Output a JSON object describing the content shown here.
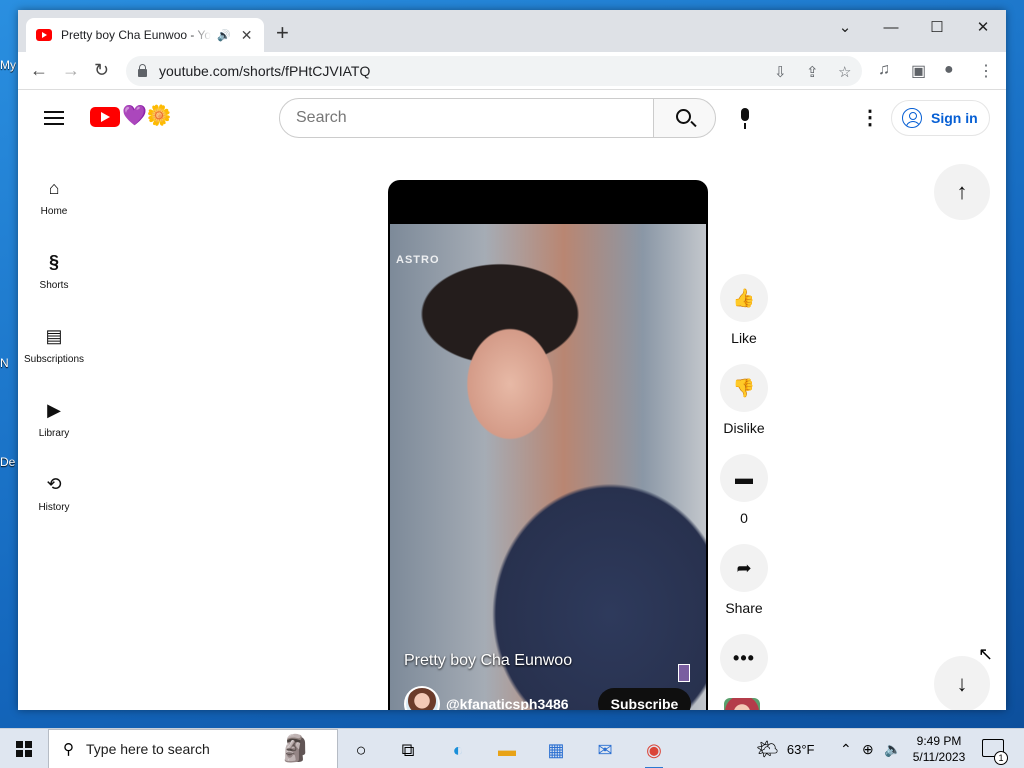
{
  "desktop": {
    "fragments": [
      "My",
      "N",
      "De"
    ]
  },
  "browser": {
    "tab": {
      "title": "Pretty boy Cha Eunwoo - YouTube",
      "audio_icon": "speaker-icon",
      "close": "✕"
    },
    "new_tab": "+",
    "window_controls": {
      "minimize": "—",
      "maximize": "☐",
      "close": "✕",
      "tablist": "⌄"
    },
    "url": "youtube.com/shorts/fPHtCJVIATQ",
    "nav": {
      "back": "←",
      "forward": "→",
      "reload": "↻"
    },
    "toolbar_icons": {
      "install": "⇩",
      "share": "⇪",
      "bookmark": "☆",
      "media": "♫",
      "sidepanel": "▣",
      "profile": "●",
      "menu": "⋮"
    }
  },
  "youtube": {
    "search_placeholder": "Search",
    "sign_in": "Sign in",
    "doodle": "💜🌼",
    "sidebar": [
      {
        "label": "Home",
        "icon": "⌂"
      },
      {
        "label": "Shorts",
        "icon": "§"
      },
      {
        "label": "Subscriptions",
        "icon": "▤"
      },
      {
        "label": "Library",
        "icon": "▶"
      },
      {
        "label": "History",
        "icon": "⟲"
      }
    ],
    "short": {
      "watermark": "ASTRO",
      "title": "Pretty boy Cha Eunwoo",
      "channel": "@kfanaticsph3486",
      "subscribe": "Subscribe"
    },
    "actions": [
      {
        "label": "Like",
        "icon": "👍"
      },
      {
        "label": "Dislike",
        "icon": "👎"
      },
      {
        "label": "0",
        "icon": "▬"
      },
      {
        "label": "Share",
        "icon": "➦"
      },
      {
        "label": "",
        "icon": "•••"
      }
    ],
    "nav_up": "↑",
    "nav_down": "↓"
  },
  "taskbar": {
    "search_placeholder": "Type here to search",
    "weather": "63°F",
    "time": "9:49 PM",
    "date": "5/11/2023",
    "notification_count": "1"
  }
}
